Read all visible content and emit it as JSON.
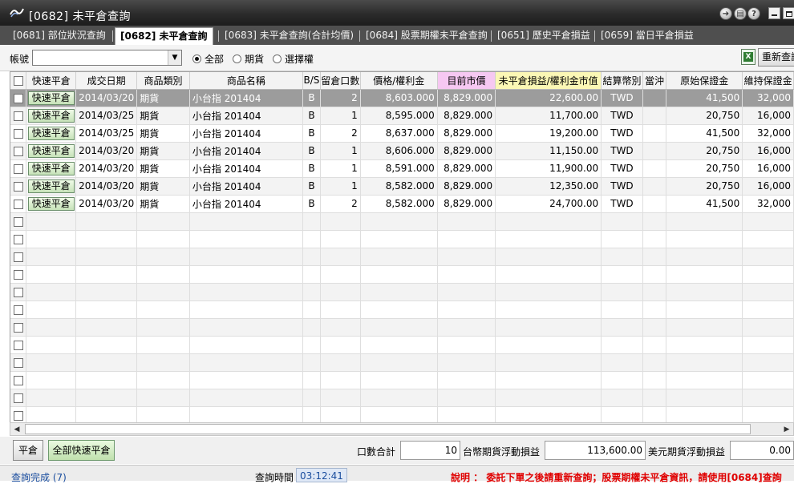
{
  "window": {
    "title": "[0682] 未平倉查詢"
  },
  "tabs": [
    {
      "label": "[0681] 部位狀況查詢",
      "active": false
    },
    {
      "label": "[0682] 未平倉查詢",
      "active": true
    },
    {
      "label": "[0683] 未平倉查詢(合計均價)",
      "active": false
    },
    {
      "label": "[0684] 股票期權未平倉查詢",
      "active": false
    },
    {
      "label": "[0651] 歷史平倉損益",
      "active": false
    },
    {
      "label": "[0659] 當日平倉損益",
      "active": false
    }
  ],
  "filter": {
    "account_label": "帳號",
    "account_value": "",
    "radios": [
      {
        "label": "全部",
        "checked": true
      },
      {
        "label": "期貨",
        "checked": false
      },
      {
        "label": "選擇權",
        "checked": false
      }
    ],
    "excel_icon": "excel-export-icon",
    "requery_label": "重新查詢"
  },
  "grid": {
    "headers": [
      "快速平倉",
      "成交日期",
      "商品類別",
      "商品名稱",
      "B/S",
      "留倉口數",
      "價格/權利金",
      "目前市價",
      "未平倉損益/權利金市值",
      "結算幣別",
      "當沖",
      "原始保證金",
      "維持保證金"
    ],
    "header_colors": {
      "current_price": "#f6c8f2",
      "unrealized_pl": "#fbf7b5"
    },
    "quick_label": "快速平倉",
    "rows": [
      {
        "date": "2014/03/20",
        "category": "期貨",
        "product": "小台指 201404",
        "bs": "B",
        "qty": "2",
        "price": "8,603.000",
        "market": "8,829.000",
        "pl": "22,600.00",
        "currency": "TWD",
        "daytrade": "",
        "init_margin": "41,500",
        "maint_margin": "32,000"
      },
      {
        "date": "2014/03/25",
        "category": "期貨",
        "product": "小台指 201404",
        "bs": "B",
        "qty": "1",
        "price": "8,595.000",
        "market": "8,829.000",
        "pl": "11,700.00",
        "currency": "TWD",
        "daytrade": "",
        "init_margin": "20,750",
        "maint_margin": "16,000"
      },
      {
        "date": "2014/03/25",
        "category": "期貨",
        "product": "小台指 201404",
        "bs": "B",
        "qty": "2",
        "price": "8,637.000",
        "market": "8,829.000",
        "pl": "19,200.00",
        "currency": "TWD",
        "daytrade": "",
        "init_margin": "41,500",
        "maint_margin": "32,000"
      },
      {
        "date": "2014/03/20",
        "category": "期貨",
        "product": "小台指 201404",
        "bs": "B",
        "qty": "1",
        "price": "8,606.000",
        "market": "8,829.000",
        "pl": "11,150.00",
        "currency": "TWD",
        "daytrade": "",
        "init_margin": "20,750",
        "maint_margin": "16,000"
      },
      {
        "date": "2014/03/20",
        "category": "期貨",
        "product": "小台指 201404",
        "bs": "B",
        "qty": "1",
        "price": "8,591.000",
        "market": "8,829.000",
        "pl": "11,900.00",
        "currency": "TWD",
        "daytrade": "",
        "init_margin": "20,750",
        "maint_margin": "16,000"
      },
      {
        "date": "2014/03/20",
        "category": "期貨",
        "product": "小台指 201404",
        "bs": "B",
        "qty": "1",
        "price": "8,582.000",
        "market": "8,829.000",
        "pl": "12,350.00",
        "currency": "TWD",
        "daytrade": "",
        "init_margin": "20,750",
        "maint_margin": "16,000"
      },
      {
        "date": "2014/03/20",
        "category": "期貨",
        "product": "小台指 201404",
        "bs": "B",
        "qty": "2",
        "price": "8,582.000",
        "market": "8,829.000",
        "pl": "24,700.00",
        "currency": "TWD",
        "daytrade": "",
        "init_margin": "41,500",
        "maint_margin": "32,000"
      }
    ],
    "empty_rows": 12,
    "selected_row": 0
  },
  "bottom": {
    "close_label": "平倉",
    "close_all_label": "全部快速平倉",
    "qty_total_label": "口數合計",
    "qty_total_value": "10",
    "twd_float_label": "台幣期貨浮動損益",
    "twd_float_value": "113,600.00",
    "usd_float_label": "美元期貨浮動損益",
    "usd_float_value": "0.00"
  },
  "status": {
    "done_text": "查詢完成 (7)",
    "query_time_label": "查詢時間",
    "query_time_value": "03:12:41",
    "note": "說明 ： 委託下單之後請重新查詢；股票期權未平倉資訊，請使用[0684]查詢"
  }
}
